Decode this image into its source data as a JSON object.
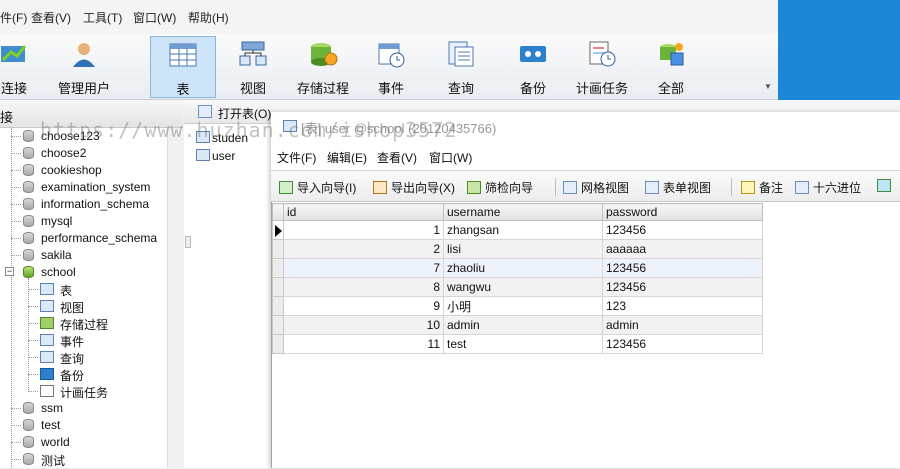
{
  "menubar": {
    "items": [
      "件(F)",
      "查看(V)",
      "工具(T)",
      "窗口(W)",
      "帮助(H)"
    ]
  },
  "toolbar": {
    "buttons": [
      {
        "label": "连接",
        "icon": "connect-icon"
      },
      {
        "label": "管理用户",
        "icon": "user-icon"
      },
      {
        "label": "表",
        "icon": "table-icon"
      },
      {
        "label": "视图",
        "icon": "view-icon"
      },
      {
        "label": "存储过程",
        "icon": "procedure-icon"
      },
      {
        "label": "事件",
        "icon": "event-icon"
      },
      {
        "label": "查询",
        "icon": "query-icon"
      },
      {
        "label": "备份",
        "icon": "backup-icon"
      },
      {
        "label": "计画任务",
        "icon": "schedule-icon"
      },
      {
        "label": "全部",
        "icon": "all-icon"
      }
    ]
  },
  "tree": {
    "header": "接",
    "databases": [
      {
        "name": "choose123",
        "open": false
      },
      {
        "name": "choose2",
        "open": false
      },
      {
        "name": "cookieshop",
        "open": false
      },
      {
        "name": "examination_system",
        "open": false
      },
      {
        "name": "information_schema",
        "open": false
      },
      {
        "name": "mysql",
        "open": false
      },
      {
        "name": "performance_schema",
        "open": false
      },
      {
        "name": "sakila",
        "open": false
      },
      {
        "name": "school",
        "open": true
      }
    ],
    "school_children": [
      "表",
      "视图",
      "存储过程",
      "事件",
      "查询",
      "备份",
      "计画任务"
    ],
    "databases_after": [
      "ssm",
      "test",
      "world",
      "测试"
    ]
  },
  "mid": {
    "open_table_label": "打开表(O)",
    "tables": [
      "studen",
      "user"
    ]
  },
  "window": {
    "title": "[表] user @school (20120435766)",
    "menu": [
      "文件(F)",
      "编辑(E)",
      "查看(V)",
      "窗口(W)"
    ],
    "toolbar": [
      "导入向导(I)",
      "导出向导(X)",
      "筛检向导",
      "网格视图",
      "表单视图",
      "备注",
      "十六进位"
    ]
  },
  "grid": {
    "columns": [
      "id",
      "username",
      "password"
    ],
    "rows": [
      {
        "id": "1",
        "username": "zhangsan",
        "password": "123456"
      },
      {
        "id": "2",
        "username": "lisi",
        "password": "aaaaaa"
      },
      {
        "id": "7",
        "username": "zhaoliu",
        "password": "123456"
      },
      {
        "id": "8",
        "username": "wangwu",
        "password": "123456"
      },
      {
        "id": "9",
        "username": "小明",
        "password": "123"
      },
      {
        "id": "10",
        "username": "admin",
        "password": "admin"
      },
      {
        "id": "11",
        "username": "test",
        "password": "123456"
      }
    ]
  },
  "watermark": "https://www.huzhan.com/ishop3572",
  "colors": {
    "accent": "#1e86d6",
    "selected_button": "#cde3f7",
    "open_db": "#5fa92a"
  }
}
